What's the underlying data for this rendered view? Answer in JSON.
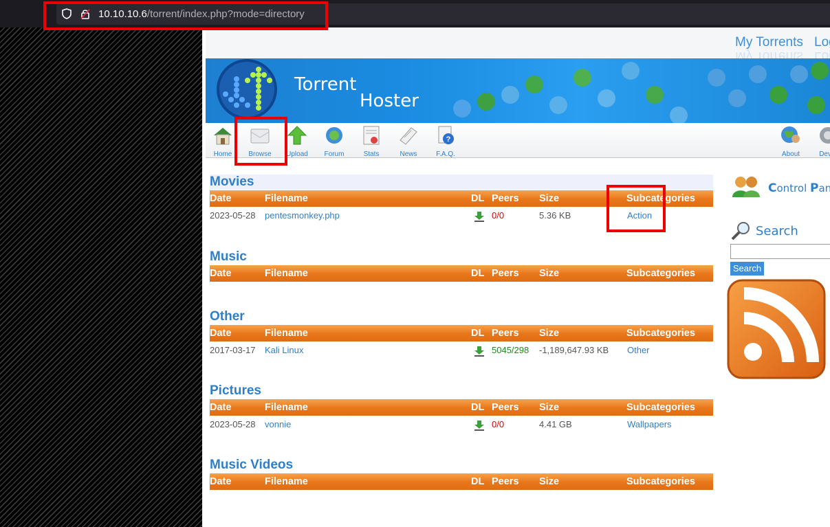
{
  "browser": {
    "url_host": "10.10.10.6",
    "url_path": "/torrent/index.php?mode=directory"
  },
  "header": {
    "my_torrents": "My Torrents",
    "login": "Log",
    "banner_title_1": "Torrent",
    "banner_title_2": "Hoster"
  },
  "nav": {
    "items": [
      {
        "label": "Home",
        "icon": "home-icon"
      },
      {
        "label": "Browse",
        "icon": "browse-icon"
      },
      {
        "label": "Upload",
        "icon": "upload-icon"
      },
      {
        "label": "Forum",
        "icon": "forum-icon"
      },
      {
        "label": "Stats",
        "icon": "stats-icon"
      },
      {
        "label": "News",
        "icon": "news-icon"
      },
      {
        "label": "F.A.Q.",
        "icon": "faq-icon"
      },
      {
        "label": "About",
        "icon": "about-icon"
      },
      {
        "label": "Devel",
        "icon": "developer-icon"
      }
    ]
  },
  "table_headers": {
    "date": "Date",
    "filename": "Filename",
    "dl": "DL",
    "peers": "Peers",
    "size": "Size",
    "subcategories": "Subcategories"
  },
  "categories": [
    {
      "name": "Movies",
      "rows": [
        {
          "date": "2023-05-28",
          "filename": "pentesmonkey.php",
          "peers": "0/0",
          "size": "5.36 KB",
          "subcategory": "Action"
        }
      ]
    },
    {
      "name": "Music",
      "rows": []
    },
    {
      "name": "Other",
      "rows": [
        {
          "date": "2017-03-17",
          "filename": "Kali Linux",
          "peers": "5045/298",
          "size": "-1,189,647.93 KB",
          "subcategory": "Other"
        }
      ]
    },
    {
      "name": "Pictures",
      "rows": [
        {
          "date": "2023-05-28",
          "filename": "vonnie",
          "peers": "0/0",
          "size": "4.41 GB",
          "subcategory": "Wallpapers"
        }
      ]
    },
    {
      "name": "Music Videos",
      "rows": []
    }
  ],
  "sidebar": {
    "control_panel_initial_1": "C",
    "control_panel_rest_1": "ontrol ",
    "control_panel_initial_2": "P",
    "control_panel_rest_2": "anel",
    "search_label": "Search",
    "search_button": "Search",
    "search_value": ""
  },
  "colors": {
    "accent_blue": "#2f7fc8",
    "header_orange": "#e8761a",
    "highlight_red": "#ef0000"
  }
}
